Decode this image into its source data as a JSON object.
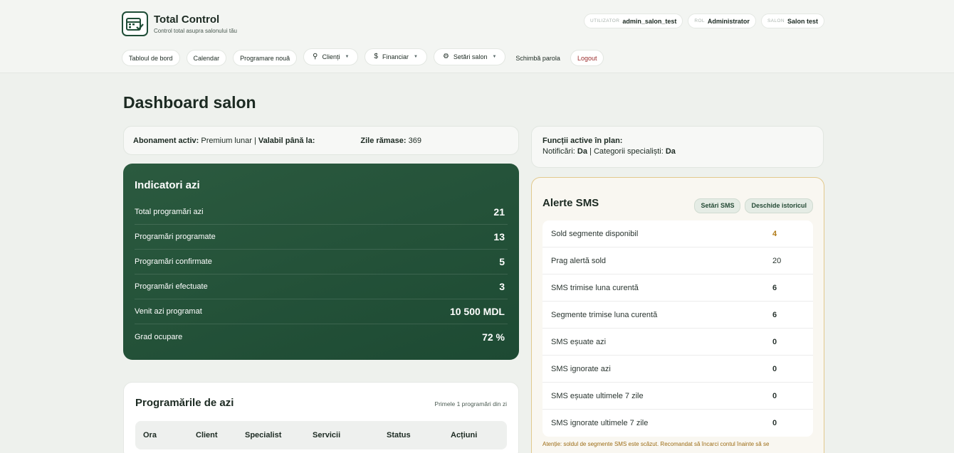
{
  "brand": {
    "title": "Total Control",
    "subtitle": "Control total asupra salonului tău"
  },
  "user": [
    {
      "key": "UTILIZATOR",
      "value": "admin_salon_test"
    },
    {
      "key": "ROL",
      "value": "Administrator"
    },
    {
      "key": "SALON",
      "value": "Salon test"
    }
  ],
  "nav": {
    "dashboard": "Tabloul de bord",
    "calendar": "Calendar",
    "new_appointment": "Programare nouă",
    "clients": "Clienți",
    "financial": "Financiar",
    "salon_settings": "Setări salon",
    "change_password": "Schimbă parola",
    "logout": "Logout"
  },
  "page_title": "Dashboard salon",
  "subscription": {
    "active_label": "Abonament activ:",
    "plan": "Premium lunar",
    "valid_label": "Valabil până la:",
    "days_label": "Zile rămase:",
    "days": "369"
  },
  "features": {
    "title": "Funcții active în plan:",
    "notif_label": "Notificări:",
    "notif_value": "Da",
    "cat_label": "Categorii specialiști:",
    "cat_value": "Da"
  },
  "indicators": {
    "title": "Indicatori azi",
    "rows": [
      {
        "label": "Total programări azi",
        "value": "21"
      },
      {
        "label": "Programări programate",
        "value": "13"
      },
      {
        "label": "Programări confirmate",
        "value": "5"
      },
      {
        "label": "Programări efectuate",
        "value": "3"
      },
      {
        "label": "Venit azi programat",
        "value": "10 500 MDL"
      },
      {
        "label": "Grad ocupare",
        "value": "72 %"
      }
    ]
  },
  "sms": {
    "title": "Alerte SMS",
    "settings_btn": "Setări SMS",
    "history_btn": "Deschide istoricul",
    "rows": [
      {
        "label": "Sold segmente disponibil",
        "value": "4"
      },
      {
        "label": "Prag alertă sold",
        "value": "20"
      },
      {
        "label": "SMS trimise luna curentă",
        "value": "6"
      },
      {
        "label": "Segmente trimise luna curentă",
        "value": "6"
      },
      {
        "label": "SMS eșuate azi",
        "value": "0"
      },
      {
        "label": "SMS ignorate azi",
        "value": "0"
      },
      {
        "label": "SMS eșuate ultimele 7 zile",
        "value": "0"
      },
      {
        "label": "SMS ignorate ultimele 7 zile",
        "value": "0"
      }
    ],
    "warning": "Atenție: soldul de segmente SMS este scăzut. Recomandat să încarci contul înainte să se"
  },
  "appointments": {
    "title": "Programările de azi",
    "note": "Primele 1 programări din zi",
    "columns": [
      "Ora",
      "Client",
      "Specialist",
      "Servicii",
      "Status",
      "Acțiuni"
    ]
  },
  "colors": {
    "accent": "#1f4d37",
    "warning": "#b07a16",
    "logout": "#9b2d2d"
  }
}
